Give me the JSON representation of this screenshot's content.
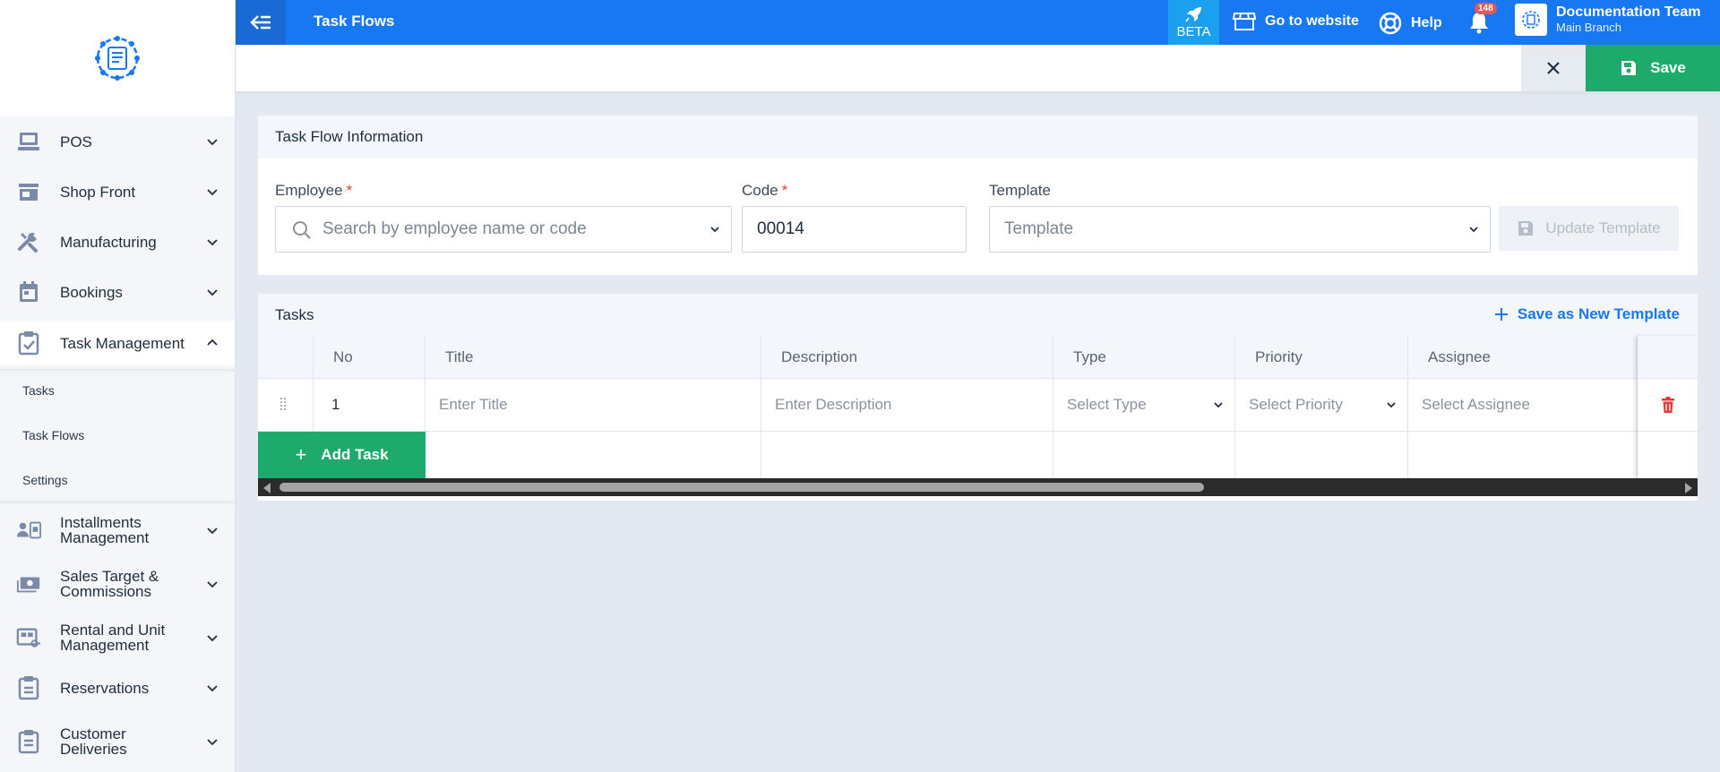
{
  "sidebar": {
    "items": [
      {
        "label": "POS",
        "icon": "laptop-icon",
        "open": false
      },
      {
        "label": "Shop Front",
        "icon": "store-icon",
        "open": false
      },
      {
        "label": "Manufacturing",
        "icon": "tools-icon",
        "open": false
      },
      {
        "label": "Bookings",
        "icon": "calendar-icon",
        "open": false
      },
      {
        "label": "Task Management",
        "icon": "clipboard-check-icon",
        "open": true
      },
      {
        "label_line1": "Installments",
        "label_line2": "Management",
        "icon": "id-card-icon"
      },
      {
        "label_line1": "Sales Target &",
        "label_line2": "Commissions",
        "icon": "money-icon"
      },
      {
        "label_line1": "Rental and Unit",
        "label_line2": "Management",
        "icon": "building-key-icon"
      },
      {
        "label": "Reservations",
        "icon": "clipboard-icon"
      },
      {
        "label_line1": "Customer",
        "label_line2": "Deliveries",
        "icon": "clipboard-list-icon"
      }
    ],
    "subitems": [
      "Tasks",
      "Task Flows",
      "Settings"
    ]
  },
  "topbar": {
    "title": "Task Flows",
    "beta": "BETA",
    "go_to_website": "Go to website",
    "help": "Help",
    "notification_count": "148",
    "account_name": "Documentation Team",
    "account_branch": "Main Branch"
  },
  "actionbar": {
    "save_label": "Save"
  },
  "info_panel": {
    "title": "Task Flow Information",
    "employee_label": "Employee",
    "employee_placeholder": "Search by employee name or code",
    "code_label": "Code",
    "code_value": "00014",
    "template_label": "Template",
    "template_placeholder": "Template",
    "update_template_label": "Update Template",
    "required_mark": "*"
  },
  "tasks_panel": {
    "title": "Tasks",
    "save_template_label": "Save as New Template",
    "columns": [
      "No",
      "Title",
      "Description",
      "Type",
      "Priority",
      "Assignee"
    ],
    "rows": [
      {
        "no": "1",
        "title_placeholder": "Enter Title",
        "description_placeholder": "Enter Description",
        "type_placeholder": "Select Type",
        "priority_placeholder": "Select Priority",
        "assignee_placeholder": "Select Assignee"
      }
    ],
    "add_task_label": "Add Task"
  },
  "colors": {
    "primary": "#1877f2",
    "success": "#1daa6b",
    "danger": "#e33b3b"
  }
}
